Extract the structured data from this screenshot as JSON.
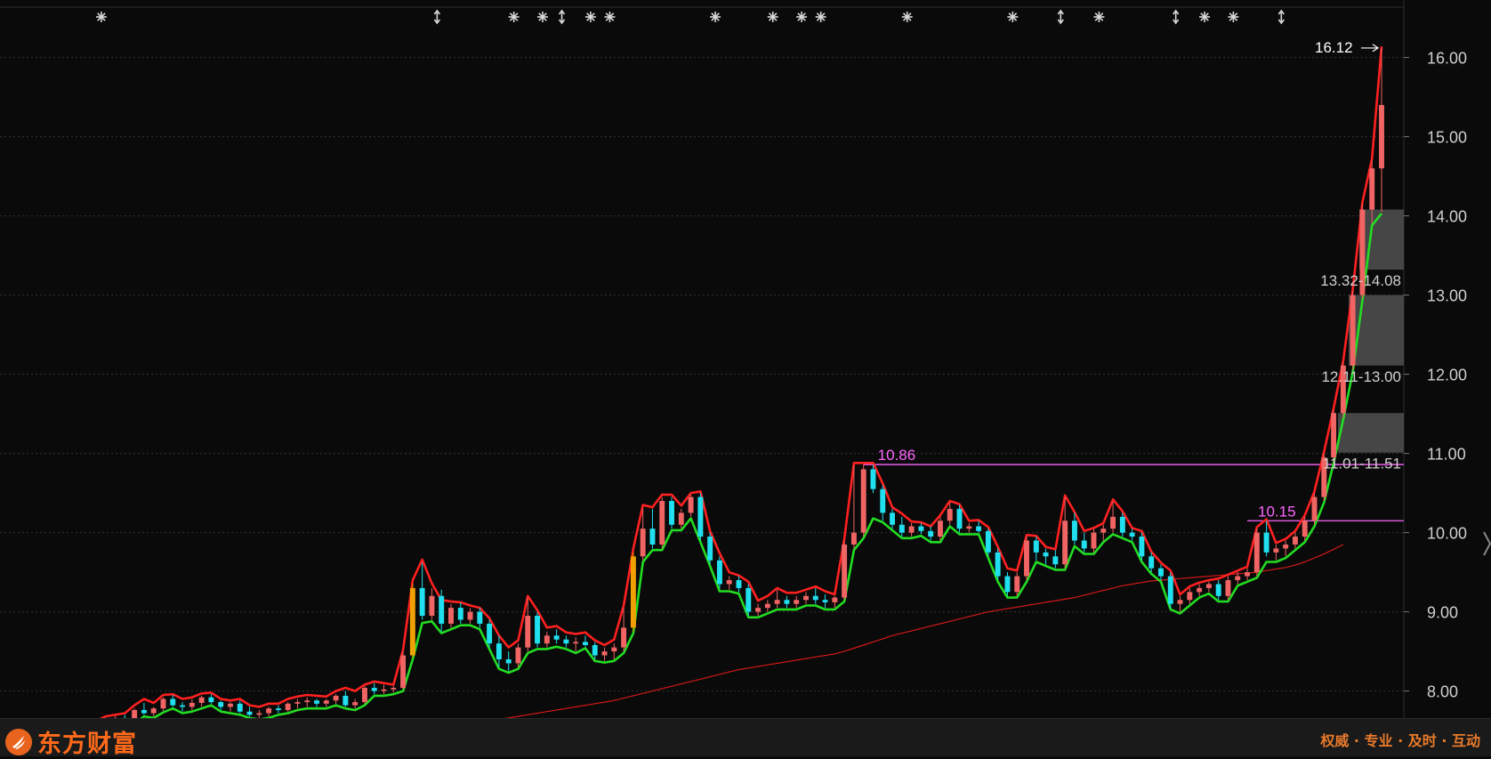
{
  "brand": {
    "name": "东方财富",
    "slogan": "权威 · 专业 · 及时 · 互动",
    "logo_icon": "eastmoney-flame-icon"
  },
  "chart_data": {
    "type": "candlestick",
    "y_axis": {
      "ticks": [
        "8.00",
        "9.00",
        "10.00",
        "11.00",
        "12.00",
        "13.00",
        "14.00",
        "15.00",
        "16.00"
      ],
      "ylim": [
        7.6,
        16.5
      ],
      "position": "right"
    },
    "grid": true,
    "annotations": {
      "high_label": "16.12",
      "levels": [
        {
          "label": "10.86",
          "value": 10.86
        },
        {
          "label": "10.15",
          "value": 10.15
        }
      ],
      "gaps": [
        {
          "label": "13.32-14.08",
          "low": 13.32,
          "high": 14.08
        },
        {
          "label": "12.11-13.00",
          "low": 12.11,
          "high": 13.0
        },
        {
          "label": "11.01-11.51",
          "low": 11.01,
          "high": 11.51
        }
      ]
    },
    "series": [
      {
        "role": "upper-band",
        "color": "#ff2020"
      },
      {
        "role": "lower-band",
        "color": "#22dd22"
      },
      {
        "role": "long-ma",
        "color": "#d01818"
      }
    ],
    "candles": [
      [
        7.55,
        7.62,
        7.5,
        7.6
      ],
      [
        7.6,
        7.66,
        7.55,
        7.58
      ],
      [
        7.58,
        7.68,
        7.56,
        7.66
      ],
      [
        7.66,
        7.7,
        7.6,
        7.62
      ],
      [
        7.62,
        7.78,
        7.6,
        7.76
      ],
      [
        7.76,
        7.85,
        7.7,
        7.72
      ],
      [
        7.72,
        7.8,
        7.68,
        7.78
      ],
      [
        7.78,
        7.92,
        7.75,
        7.9
      ],
      [
        7.9,
        7.95,
        7.8,
        7.82
      ],
      [
        7.82,
        7.86,
        7.74,
        7.8
      ],
      [
        7.8,
        7.9,
        7.76,
        7.85
      ],
      [
        7.85,
        7.94,
        7.8,
        7.92
      ],
      [
        7.92,
        7.96,
        7.84,
        7.86
      ],
      [
        7.86,
        7.88,
        7.76,
        7.8
      ],
      [
        7.8,
        7.86,
        7.74,
        7.84
      ],
      [
        7.84,
        7.88,
        7.72,
        7.74
      ],
      [
        7.74,
        7.8,
        7.68,
        7.7
      ],
      [
        7.7,
        7.76,
        7.66,
        7.72
      ],
      [
        7.72,
        7.8,
        7.68,
        7.78
      ],
      [
        7.78,
        7.82,
        7.72,
        7.76
      ],
      [
        7.76,
        7.86,
        7.74,
        7.84
      ],
      [
        7.84,
        7.9,
        7.78,
        7.86
      ],
      [
        7.86,
        7.92,
        7.8,
        7.88
      ],
      [
        7.88,
        7.9,
        7.8,
        7.84
      ],
      [
        7.84,
        7.9,
        7.8,
        7.88
      ],
      [
        7.88,
        7.96,
        7.84,
        7.94
      ],
      [
        7.94,
        8.0,
        7.8,
        7.82
      ],
      [
        7.82,
        7.9,
        7.78,
        7.86
      ],
      [
        7.86,
        8.06,
        7.84,
        8.04
      ],
      [
        8.04,
        8.1,
        7.96,
        8.0
      ],
      [
        8.0,
        8.08,
        7.96,
        8.02
      ],
      [
        8.02,
        8.06,
        7.98,
        8.04
      ],
      [
        8.04,
        8.5,
        8.02,
        8.45
      ],
      [
        8.45,
        9.35,
        8.42,
        9.3
      ],
      [
        9.3,
        9.62,
        8.9,
        8.95
      ],
      [
        8.95,
        9.3,
        8.9,
        9.2
      ],
      [
        9.2,
        9.28,
        8.75,
        8.85
      ],
      [
        8.85,
        9.1,
        8.8,
        9.05
      ],
      [
        9.05,
        9.12,
        8.85,
        8.9
      ],
      [
        8.9,
        9.05,
        8.85,
        9.0
      ],
      [
        9.0,
        9.05,
        8.8,
        8.85
      ],
      [
        8.85,
        8.9,
        8.55,
        8.6
      ],
      [
        8.6,
        8.7,
        8.3,
        8.4
      ],
      [
        8.4,
        8.5,
        8.25,
        8.35
      ],
      [
        8.35,
        8.6,
        8.3,
        8.55
      ],
      [
        8.55,
        9.18,
        8.5,
        8.95
      ],
      [
        8.95,
        9.0,
        8.55,
        8.6
      ],
      [
        8.6,
        8.75,
        8.55,
        8.7
      ],
      [
        8.7,
        8.78,
        8.6,
        8.65
      ],
      [
        8.65,
        8.7,
        8.55,
        8.6
      ],
      [
        8.6,
        8.68,
        8.5,
        8.62
      ],
      [
        8.62,
        8.7,
        8.56,
        8.58
      ],
      [
        8.58,
        8.62,
        8.4,
        8.45
      ],
      [
        8.45,
        8.55,
        8.38,
        8.5
      ],
      [
        8.5,
        8.6,
        8.4,
        8.55
      ],
      [
        8.55,
        9.05,
        8.5,
        8.8
      ],
      [
        8.8,
        9.75,
        8.75,
        9.7
      ],
      [
        9.7,
        10.3,
        9.65,
        10.05
      ],
      [
        10.05,
        10.3,
        9.8,
        9.85
      ],
      [
        9.85,
        10.45,
        9.8,
        10.4
      ],
      [
        10.4,
        10.45,
        10.05,
        10.1
      ],
      [
        10.1,
        10.3,
        10.05,
        10.25
      ],
      [
        10.25,
        10.48,
        10.2,
        10.45
      ],
      [
        10.45,
        10.5,
        9.9,
        9.95
      ],
      [
        9.95,
        10.0,
        9.6,
        9.65
      ],
      [
        9.65,
        9.7,
        9.3,
        9.35
      ],
      [
        9.35,
        9.45,
        9.28,
        9.4
      ],
      [
        9.4,
        9.45,
        9.25,
        9.3
      ],
      [
        9.3,
        9.35,
        8.95,
        9.0
      ],
      [
        9.0,
        9.1,
        8.95,
        9.05
      ],
      [
        9.05,
        9.15,
        9.0,
        9.1
      ],
      [
        9.1,
        9.28,
        9.05,
        9.15
      ],
      [
        9.15,
        9.2,
        9.05,
        9.1
      ],
      [
        9.1,
        9.2,
        9.05,
        9.15
      ],
      [
        9.15,
        9.25,
        9.1,
        9.2
      ],
      [
        9.2,
        9.3,
        9.1,
        9.15
      ],
      [
        9.15,
        9.22,
        9.05,
        9.12
      ],
      [
        9.12,
        9.2,
        9.05,
        9.18
      ],
      [
        9.18,
        9.9,
        9.15,
        9.85
      ],
      [
        9.85,
        10.85,
        9.8,
        10.0
      ],
      [
        10.0,
        10.86,
        9.95,
        10.8
      ],
      [
        10.8,
        10.86,
        10.5,
        10.55
      ],
      [
        10.55,
        10.6,
        10.15,
        10.25
      ],
      [
        10.25,
        10.3,
        10.05,
        10.1
      ],
      [
        10.1,
        10.2,
        9.95,
        10.0
      ],
      [
        10.0,
        10.12,
        9.95,
        10.08
      ],
      [
        10.08,
        10.12,
        9.98,
        10.02
      ],
      [
        10.02,
        10.08,
        9.9,
        9.95
      ],
      [
        9.95,
        10.2,
        9.9,
        10.15
      ],
      [
        10.15,
        10.38,
        10.1,
        10.3
      ],
      [
        10.3,
        10.35,
        10.0,
        10.05
      ],
      [
        10.05,
        10.12,
        10.0,
        10.08
      ],
      [
        10.08,
        10.15,
        10.0,
        10.02
      ],
      [
        10.02,
        10.05,
        9.7,
        9.75
      ],
      [
        9.75,
        9.8,
        9.4,
        9.45
      ],
      [
        9.45,
        9.5,
        9.2,
        9.25
      ],
      [
        9.25,
        9.5,
        9.2,
        9.45
      ],
      [
        9.45,
        9.95,
        9.4,
        9.9
      ],
      [
        9.9,
        9.95,
        9.65,
        9.75
      ],
      [
        9.75,
        9.8,
        9.6,
        9.7
      ],
      [
        9.7,
        9.78,
        9.55,
        9.6
      ],
      [
        9.6,
        10.45,
        9.55,
        10.15
      ],
      [
        10.15,
        10.25,
        9.85,
        9.9
      ],
      [
        9.9,
        10.0,
        9.75,
        9.8
      ],
      [
        9.8,
        10.05,
        9.75,
        10.0
      ],
      [
        10.0,
        10.1,
        9.9,
        10.05
      ],
      [
        10.05,
        10.4,
        10.0,
        10.2
      ],
      [
        10.2,
        10.25,
        9.95,
        10.0
      ],
      [
        10.0,
        10.05,
        9.9,
        9.95
      ],
      [
        9.95,
        10.0,
        9.65,
        9.7
      ],
      [
        9.7,
        9.75,
        9.5,
        9.55
      ],
      [
        9.55,
        9.6,
        9.4,
        9.45
      ],
      [
        9.45,
        9.5,
        9.05,
        9.1
      ],
      [
        9.1,
        9.2,
        9.0,
        9.15
      ],
      [
        9.15,
        9.3,
        9.1,
        9.25
      ],
      [
        9.25,
        9.35,
        9.2,
        9.3
      ],
      [
        9.3,
        9.38,
        9.25,
        9.35
      ],
      [
        9.35,
        9.4,
        9.15,
        9.2
      ],
      [
        9.2,
        9.45,
        9.15,
        9.4
      ],
      [
        9.4,
        9.5,
        9.35,
        9.45
      ],
      [
        9.45,
        9.55,
        9.4,
        9.5
      ],
      [
        9.5,
        10.05,
        9.45,
        10.0
      ],
      [
        10.0,
        10.15,
        9.7,
        9.75
      ],
      [
        9.75,
        9.85,
        9.65,
        9.8
      ],
      [
        9.8,
        9.9,
        9.7,
        9.85
      ],
      [
        9.85,
        10.0,
        9.8,
        9.95
      ],
      [
        9.95,
        10.2,
        9.9,
        10.15
      ],
      [
        10.15,
        10.5,
        10.1,
        10.45
      ],
      [
        10.45,
        11.0,
        10.4,
        10.95
      ],
      [
        10.95,
        11.55,
        10.9,
        11.51
      ],
      [
        11.51,
        12.15,
        11.45,
        12.11
      ],
      [
        12.11,
        13.05,
        12.05,
        13.0
      ],
      [
        13.0,
        14.15,
        12.95,
        14.08
      ],
      [
        14.08,
        14.7,
        13.9,
        14.6
      ],
      [
        14.6,
        16.12,
        14.05,
        15.4
      ]
    ],
    "bands": {
      "upper": [
        7.62,
        7.68,
        7.7,
        7.72,
        7.82,
        7.9,
        7.85,
        7.95,
        7.96,
        7.9,
        7.92,
        7.97,
        7.98,
        7.9,
        7.88,
        7.9,
        7.82,
        7.8,
        7.84,
        7.84,
        7.9,
        7.93,
        7.95,
        7.94,
        7.93,
        8.0,
        8.04,
        8.0,
        8.08,
        8.12,
        8.1,
        8.08,
        8.52,
        9.4,
        9.66,
        9.36,
        9.15,
        9.13,
        9.12,
        9.08,
        9.05,
        8.92,
        8.7,
        8.55,
        8.64,
        9.2,
        9.02,
        8.8,
        8.82,
        8.74,
        8.72,
        8.74,
        8.64,
        8.58,
        8.65,
        9.08,
        9.8,
        10.35,
        10.32,
        10.48,
        10.48,
        10.34,
        10.5,
        10.52,
        10.02,
        9.74,
        9.5,
        9.46,
        9.38,
        9.14,
        9.2,
        9.3,
        9.24,
        9.24,
        9.28,
        9.32,
        9.26,
        9.22,
        9.92,
        10.88,
        10.88,
        10.88,
        10.62,
        10.32,
        10.24,
        10.14,
        10.13,
        10.08,
        10.22,
        10.4,
        10.36,
        10.15,
        10.16,
        10.07,
        9.82,
        9.55,
        9.52,
        9.97,
        9.96,
        9.82,
        9.79,
        10.47,
        10.26,
        10.02,
        10.06,
        10.12,
        10.42,
        10.27,
        10.06,
        10.02,
        9.76,
        9.62,
        9.52,
        9.22,
        9.32,
        9.37,
        9.4,
        9.42,
        9.47,
        9.52,
        9.57,
        10.07,
        10.17,
        9.87,
        9.92,
        10.02,
        10.22,
        10.52,
        11.02,
        11.57,
        12.17,
        13.07,
        14.17,
        14.72,
        16.14
      ],
      "lower": [
        7.48,
        7.53,
        7.54,
        7.58,
        7.58,
        7.68,
        7.66,
        7.73,
        7.78,
        7.72,
        7.74,
        7.78,
        7.82,
        7.74,
        7.72,
        7.7,
        7.66,
        7.64,
        7.66,
        7.7,
        7.72,
        7.76,
        7.78,
        7.78,
        7.78,
        7.82,
        7.78,
        7.76,
        7.82,
        7.94,
        7.94,
        7.96,
        8.0,
        8.4,
        8.86,
        8.88,
        8.73,
        8.78,
        8.83,
        8.83,
        8.78,
        8.53,
        8.28,
        8.23,
        8.28,
        8.48,
        8.53,
        8.53,
        8.56,
        8.53,
        8.48,
        8.54,
        8.38,
        8.36,
        8.38,
        8.48,
        8.73,
        9.63,
        9.78,
        9.78,
        10.03,
        10.03,
        10.18,
        9.88,
        9.58,
        9.26,
        9.26,
        9.23,
        8.93,
        8.93,
        8.98,
        9.03,
        9.03,
        9.03,
        9.08,
        9.08,
        9.03,
        9.03,
        9.13,
        9.78,
        9.93,
        10.18,
        10.13,
        10.03,
        9.93,
        9.93,
        9.96,
        9.88,
        9.88,
        10.08,
        9.98,
        9.98,
        9.98,
        9.68,
        9.38,
        9.18,
        9.18,
        9.38,
        9.63,
        9.58,
        9.53,
        9.53,
        9.83,
        9.73,
        9.73,
        9.88,
        9.98,
        9.93,
        9.88,
        9.63,
        9.48,
        9.38,
        9.03,
        8.98,
        9.08,
        9.18,
        9.23,
        9.13,
        9.13,
        9.33,
        9.38,
        9.43,
        9.63,
        9.63,
        9.68,
        9.78,
        9.88,
        10.08,
        10.38,
        10.88,
        11.43,
        12.03,
        12.93,
        13.88,
        14.03
      ],
      "long_ma": [
        null,
        null,
        null,
        null,
        null,
        null,
        null,
        null,
        null,
        null,
        null,
        null,
        null,
        null,
        null,
        null,
        null,
        null,
        null,
        null,
        null,
        null,
        null,
        null,
        null,
        null,
        null,
        null,
        null,
        null,
        null,
        null,
        null,
        null,
        null,
        null,
        null,
        null,
        null,
        null,
        7.6,
        7.62,
        7.64,
        7.66,
        7.68,
        7.7,
        7.72,
        7.74,
        7.76,
        7.78,
        7.8,
        7.82,
        7.84,
        7.86,
        7.88,
        7.91,
        7.94,
        7.97,
        8.0,
        8.03,
        8.06,
        8.09,
        8.12,
        8.15,
        8.18,
        8.21,
        8.24,
        8.27,
        8.29,
        8.31,
        8.33,
        8.35,
        8.37,
        8.39,
        8.41,
        8.43,
        8.45,
        8.47,
        8.5,
        8.54,
        8.58,
        8.62,
        8.66,
        8.7,
        8.73,
        8.76,
        8.79,
        8.82,
        8.85,
        8.88,
        8.91,
        8.94,
        8.97,
        9.0,
        9.02,
        9.04,
        9.06,
        9.08,
        9.1,
        9.12,
        9.14,
        9.16,
        9.18,
        9.21,
        9.24,
        9.27,
        9.3,
        9.33,
        9.35,
        9.37,
        9.39,
        9.4,
        9.41,
        9.42,
        9.43,
        9.44,
        9.45,
        9.46,
        9.47,
        9.48,
        9.49,
        9.5,
        9.52,
        9.54,
        9.56,
        9.59,
        9.63,
        9.68,
        9.73,
        9.79,
        9.85,
        null,
        null,
        null,
        null
      ]
    },
    "markers": [
      {
        "i": 5,
        "type": "asterisk-icon"
      },
      {
        "i": 40,
        "type": "updown-arrow-icon"
      },
      {
        "i": 48,
        "type": "asterisk-icon"
      },
      {
        "i": 51,
        "type": "asterisk-icon"
      },
      {
        "i": 53,
        "type": "updown-arrow-icon"
      },
      {
        "i": 56,
        "type": "asterisk-icon"
      },
      {
        "i": 58,
        "type": "asterisk-icon"
      },
      {
        "i": 69,
        "type": "asterisk-icon"
      },
      {
        "i": 75,
        "type": "asterisk-icon"
      },
      {
        "i": 78,
        "type": "asterisk-icon"
      },
      {
        "i": 80,
        "type": "asterisk-icon"
      },
      {
        "i": 89,
        "type": "asterisk-icon"
      },
      {
        "i": 100,
        "type": "asterisk-icon"
      },
      {
        "i": 105,
        "type": "updown-arrow-icon"
      },
      {
        "i": 109,
        "type": "asterisk-icon"
      },
      {
        "i": 117,
        "type": "updown-arrow-icon"
      },
      {
        "i": 120,
        "type": "asterisk-icon"
      },
      {
        "i": 123,
        "type": "asterisk-icon"
      },
      {
        "i": 128,
        "type": "updown-arrow-icon"
      }
    ],
    "colors": {
      "up": "#f06464",
      "down": "#20e0f0",
      "limit_up": "#f0a000",
      "level_line": "#ff66ff",
      "gap_box": "#4a4a4a",
      "grid": "#333333"
    }
  }
}
